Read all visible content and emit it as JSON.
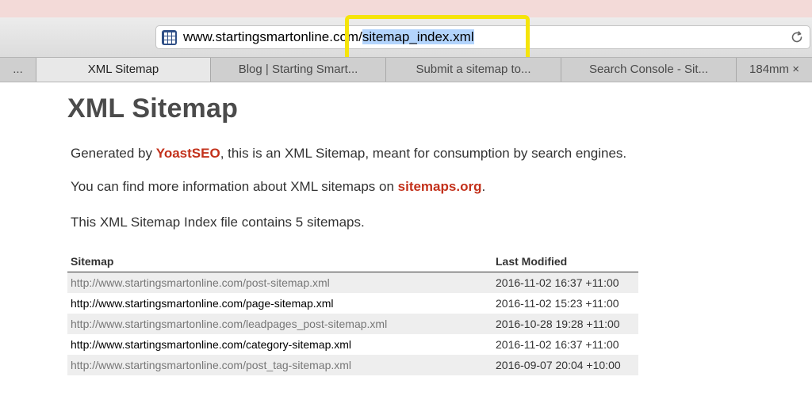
{
  "browser": {
    "url_prefix": "www.startingsmartonline.",
    "url_middle": "com/",
    "url_selected": "sitemap_index.xml"
  },
  "tabs": [
    {
      "label": "..."
    },
    {
      "label": "XML Sitemap"
    },
    {
      "label": "Blog | Starting Smart..."
    },
    {
      "label": "Submit a sitemap to..."
    },
    {
      "label": "Search Console - Sit..."
    },
    {
      "label": "184mm ×"
    }
  ],
  "page": {
    "title": "XML Sitemap",
    "generated_pre": "Generated by ",
    "generated_link": "YoastSEO",
    "generated_post": ", this is an XML Sitemap, meant for consumption by search engines.",
    "info_pre": "You can find more information about XML sitemaps on ",
    "info_link": "sitemaps.org",
    "info_post": ".",
    "count_text": "This XML Sitemap Index file contains 5 sitemaps."
  },
  "table": {
    "headers": {
      "sitemap": "Sitemap",
      "last_modified": "Last Modified"
    },
    "rows": [
      {
        "url": "http://www.startingsmartonline.com/post-sitemap.xml",
        "date": "2016-11-02 16:37 +11:00"
      },
      {
        "url": "http://www.startingsmartonline.com/page-sitemap.xml",
        "date": "2016-11-02 15:23 +11:00"
      },
      {
        "url": "http://www.startingsmartonline.com/leadpages_post-sitemap.xml",
        "date": "2016-10-28 19:28 +11:00"
      },
      {
        "url": "http://www.startingsmartonline.com/category-sitemap.xml",
        "date": "2016-11-02 16:37 +11:00"
      },
      {
        "url": "http://www.startingsmartonline.com/post_tag-sitemap.xml",
        "date": "2016-09-07 20:04 +10:00"
      }
    ]
  },
  "colors": {
    "link": "#c3311b",
    "highlight": "#f5e40a",
    "selection": "#b3d4fc"
  },
  "icons": {
    "site": "grid-icon",
    "reload": "reload-icon"
  }
}
